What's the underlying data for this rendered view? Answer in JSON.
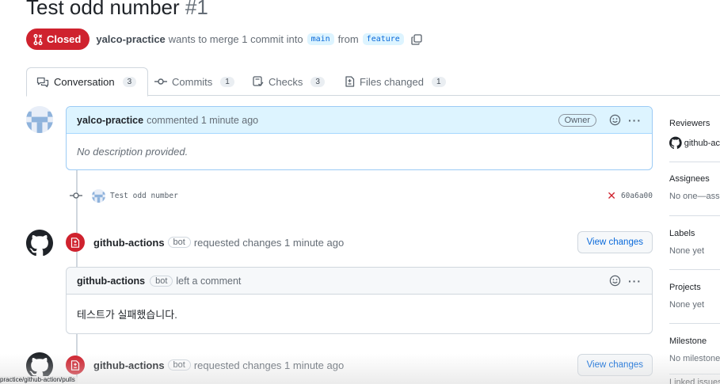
{
  "pr": {
    "title": "Test odd number",
    "number": "#1",
    "state_label": "Closed",
    "author": "yalco-practice",
    "merge_text": "wants to merge 1 commit into",
    "base_branch": "main",
    "from_text": "from",
    "head_branch": "feature"
  },
  "tabs": [
    {
      "label": "Conversation",
      "count": "3"
    },
    {
      "label": "Commits",
      "count": "1"
    },
    {
      "label": "Checks",
      "count": "3"
    },
    {
      "label": "Files changed",
      "count": "1"
    }
  ],
  "opening_comment": {
    "author": "yalco-practice",
    "action": "commented 1 minute ago",
    "role_badge": "Owner",
    "body": "No description provided."
  },
  "commit": {
    "message": "Test odd number",
    "sha": "60a6a00",
    "status": "failed"
  },
  "review_1": {
    "author": "github-actions",
    "bot_label": "bot",
    "action": "requested changes 1 minute ago",
    "button": "View changes"
  },
  "review_1_comment": {
    "author": "github-actions",
    "bot_label": "bot",
    "action": "left a comment",
    "body": "테스트가 실패했습니다."
  },
  "review_2": {
    "author": "github-actions",
    "bot_label": "bot",
    "action": "requested changes 1 minute ago",
    "button": "View changes"
  },
  "sidebar": {
    "reviewers_title": "Reviewers",
    "reviewers_value": "github-ac",
    "assignees_title": "Assignees",
    "assignees_value": "No one—assi",
    "labels_title": "Labels",
    "labels_value": "None yet",
    "projects_title": "Projects",
    "projects_value": "None yet",
    "milestone_title": "Milestone",
    "milestone_value": "No milestone",
    "linked_title": "Linked issues"
  },
  "status_bar_url": "practice/github-action/pulls",
  "colors": {
    "closed_red": "#cf222e",
    "link_blue": "#0969da",
    "owner_header_bg": "#ddf4ff"
  }
}
